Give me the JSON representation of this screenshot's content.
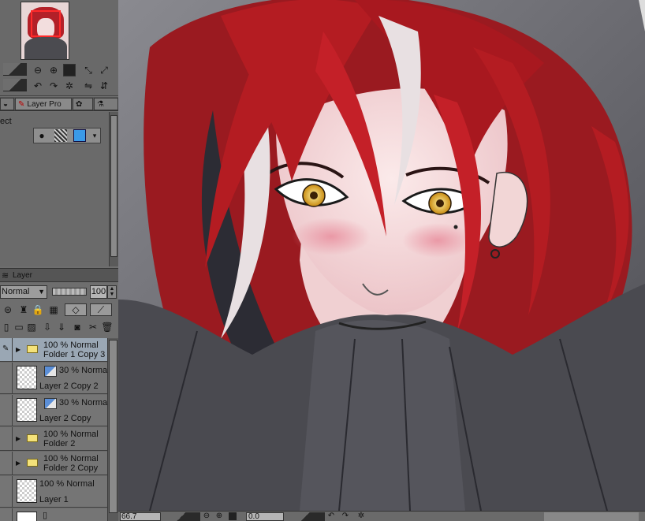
{
  "layer_property_tab": {
    "tabs": [
      "Layer Pro"
    ],
    "effect_label": "ect"
  },
  "layer_panel": {
    "tab_label": "Layer",
    "blend_mode": "Normal",
    "opacity": "100",
    "layers": [
      {
        "mode": "100 % Normal",
        "name": "Folder 1 Copy 3",
        "type": "folder",
        "selected": true
      },
      {
        "mode": "30 % Normal",
        "name": "Layer 2 Copy 2",
        "type": "raster",
        "selected": false
      },
      {
        "mode": "30 % Normal",
        "name": "Layer 2 Copy",
        "type": "raster",
        "selected": false
      },
      {
        "mode": "100 % Normal",
        "name": "Folder 2",
        "type": "folder",
        "selected": false
      },
      {
        "mode": "100 % Normal",
        "name": "Folder 2 Copy",
        "type": "folder",
        "selected": false
      },
      {
        "mode": "100 % Normal",
        "name": "Layer 1",
        "type": "raster",
        "selected": false
      }
    ]
  },
  "status": {
    "zoom": "66.7",
    "angle": "0.0"
  },
  "colors": {
    "hair": "#b41c22",
    "skin": "#f6dcdc",
    "eyes": "#e8b020",
    "cloth": "#4a4a50",
    "background": "#6e6e74"
  }
}
